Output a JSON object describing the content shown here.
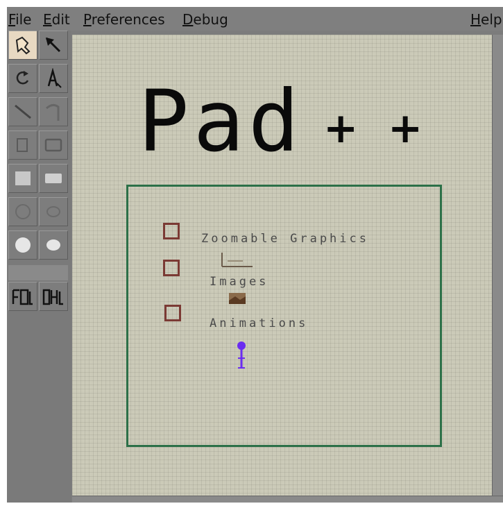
{
  "menubar": {
    "items": [
      {
        "mnemonic": "F",
        "rest": "ile"
      },
      {
        "mnemonic": "E",
        "rest": "dit"
      },
      {
        "mnemonic": "P",
        "rest": "references"
      },
      {
        "mnemonic": "D",
        "rest": "ebug"
      }
    ],
    "help": {
      "mnemonic": "H",
      "rest": "elp"
    }
  },
  "toolbox": {
    "tools": [
      "select-tool",
      "arrow-tool",
      "rotate-tool",
      "text-tool",
      "line-tool",
      "freehand-tool",
      "rectangle-outline-tool",
      "rounded-rectangle-outline-tool",
      "filled-rectangle-tool",
      "filled-rounded-rectangle-tool",
      "circle-outline-tool",
      "ellipse-outline-tool",
      "filled-circle-tool",
      "filled-ellipse-tool",
      "group-tool",
      "ungroup-tool"
    ],
    "active": "select-tool"
  },
  "canvas": {
    "title": "Pad",
    "plus": "+",
    "features": [
      "Zoomable Graphics",
      "Images",
      "Animations"
    ]
  },
  "colors": {
    "canvas": "#cbcab8",
    "frame": "#2c7048",
    "bullet": "#7b3a34",
    "animation": "#6a2cf0"
  }
}
